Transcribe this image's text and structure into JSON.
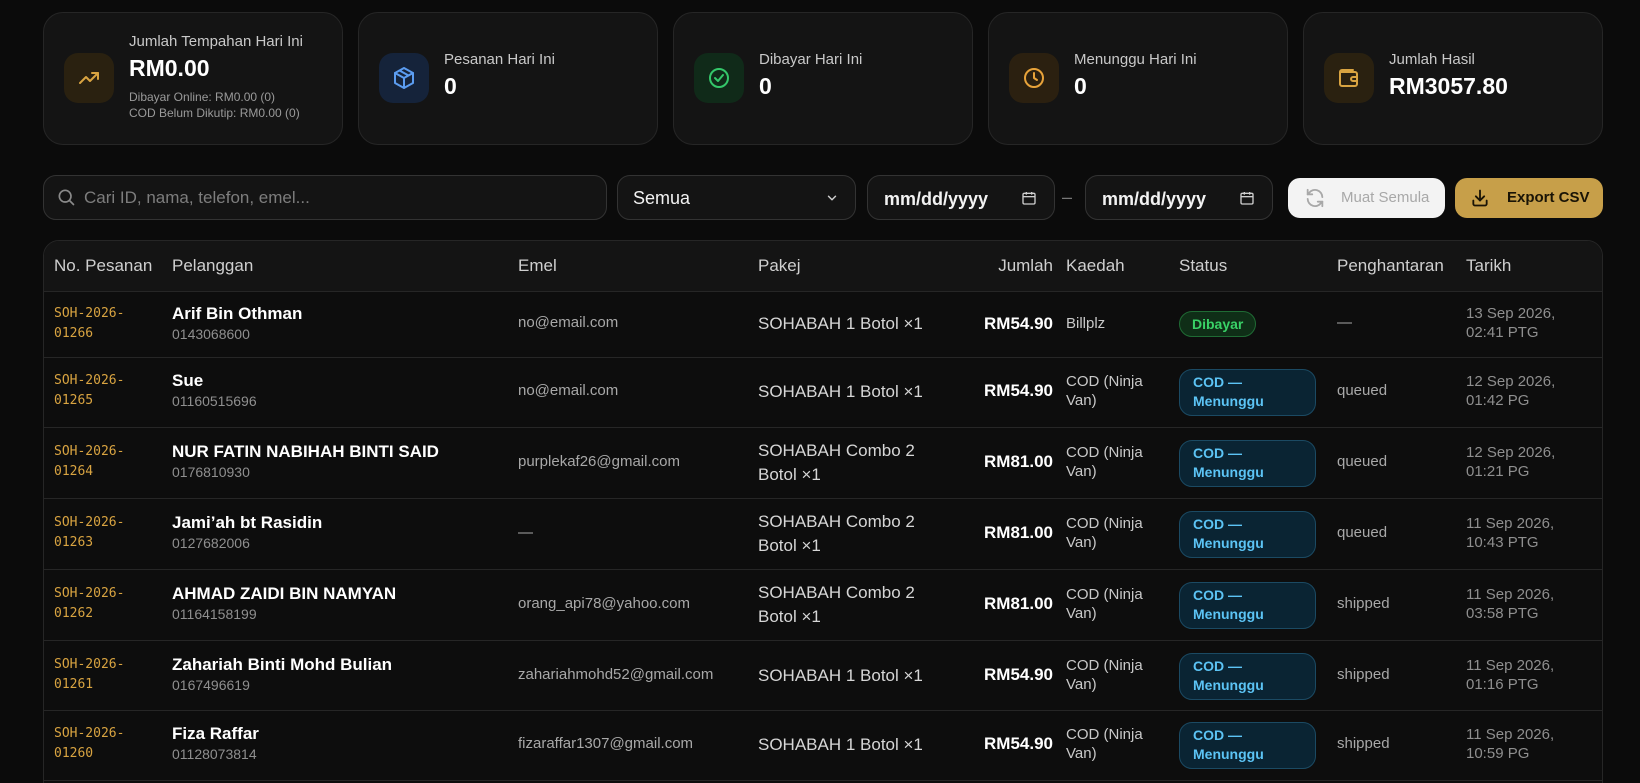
{
  "stats": [
    {
      "label": "Jumlah Tempahan Hari Ini",
      "value": "RM0.00",
      "sub1": "Dibayar Online: RM0.00 (0)",
      "sub2": "COD Belum Dikutip: RM0.00 (0)",
      "icon": "trending-up-icon",
      "color": "#d9a441"
    },
    {
      "label": "Pesanan Hari Ini",
      "value": "0",
      "icon": "package-icon",
      "color": "#5b9cf0"
    },
    {
      "label": "Dibayar Hari Ini",
      "value": "0",
      "icon": "check-circle-icon",
      "color": "#34c76a"
    },
    {
      "label": "Menunggu Hari Ini",
      "value": "0",
      "icon": "clock-icon",
      "color": "#e8a33a"
    },
    {
      "label": "Jumlah Hasil",
      "value": "RM3057.80",
      "icon": "wallet-icon",
      "color": "#d9a441"
    }
  ],
  "toolbar": {
    "search_placeholder": "Cari ID, nama, telefon, emel...",
    "filter_value": "Semua",
    "date_from": "mm/dd/yyyy",
    "date_to": "mm/dd/yyyy",
    "date_separator": "–",
    "reload_label": "Muat Semula",
    "export_label": "Export CSV"
  },
  "table": {
    "headers": [
      "No. Pesanan",
      "Pelanggan",
      "Emel",
      "Pakej",
      "Jumlah",
      "Kaedah",
      "Status",
      "Penghantaran",
      "Tarikh"
    ],
    "rows": [
      {
        "id": "SOH-2026-01266",
        "name": "Arif Bin Othman",
        "phone": "0143068600",
        "email": "no@email.com",
        "package": "SOHABAH 1 Botol ×1",
        "amount": "RM54.90",
        "method": "Billplz",
        "status": "Dibayar",
        "status_type": "paid",
        "shipping": "—",
        "date": "13 Sep 2026, 02:41 PTG"
      },
      {
        "id": "SOH-2026-01265",
        "name": "Sue",
        "phone": "01160515696",
        "email": "no@email.com",
        "package": "SOHABAH 1 Botol ×1",
        "amount": "RM54.90",
        "method": "COD (Ninja Van)",
        "status": "COD — Menunggu",
        "status_type": "cod",
        "shipping": "queued",
        "date": "12 Sep 2026, 01:42 PG"
      },
      {
        "id": "SOH-2026-01264",
        "name": "NUR FATIN NABIHAH BINTI SAID",
        "phone": "0176810930",
        "email": "purplekaf26@gmail.com",
        "package": "SOHABAH Combo 2 Botol ×1",
        "amount": "RM81.00",
        "method": "COD (Ninja Van)",
        "status": "COD — Menunggu",
        "status_type": "cod",
        "shipping": "queued",
        "date": "12 Sep 2026, 01:21 PG"
      },
      {
        "id": "SOH-2026-01263",
        "name": "Jami’ah bt Rasidin",
        "phone": "0127682006",
        "email": "—",
        "package": "SOHABAH Combo 2 Botol ×1",
        "amount": "RM81.00",
        "method": "COD (Ninja Van)",
        "status": "COD — Menunggu",
        "status_type": "cod",
        "shipping": "queued",
        "date": "11 Sep 2026, 10:43 PTG"
      },
      {
        "id": "SOH-2026-01262",
        "name": "AHMAD ZAIDI BIN NAMYAN",
        "phone": "01164158199",
        "email": "orang_api78@yahoo.com",
        "package": "SOHABAH Combo 2 Botol ×1",
        "amount": "RM81.00",
        "method": "COD (Ninja Van)",
        "status": "COD — Menunggu",
        "status_type": "cod",
        "shipping": "shipped",
        "date": "11 Sep 2026, 03:58 PTG"
      },
      {
        "id": "SOH-2026-01261",
        "name": "Zahariah Binti Mohd Bulian",
        "phone": "0167496619",
        "email": "zahariahmohd52@gmail.com",
        "package": "SOHABAH 1 Botol ×1",
        "amount": "RM54.90",
        "method": "COD (Ninja Van)",
        "status": "COD — Menunggu",
        "status_type": "cod",
        "shipping": "shipped",
        "date": "11 Sep 2026, 01:16 PTG"
      },
      {
        "id": "SOH-2026-01260",
        "name": "Fiza Raffar",
        "phone": "01128073814",
        "email": "fizaraffar1307@gmail.com",
        "package": "SOHABAH 1 Botol ×1",
        "amount": "RM54.90",
        "method": "COD (Ninja Van)",
        "status": "COD — Menunggu",
        "status_type": "cod",
        "shipping": "shipped",
        "date": "11 Sep 2026, 10:59 PG"
      }
    ]
  }
}
